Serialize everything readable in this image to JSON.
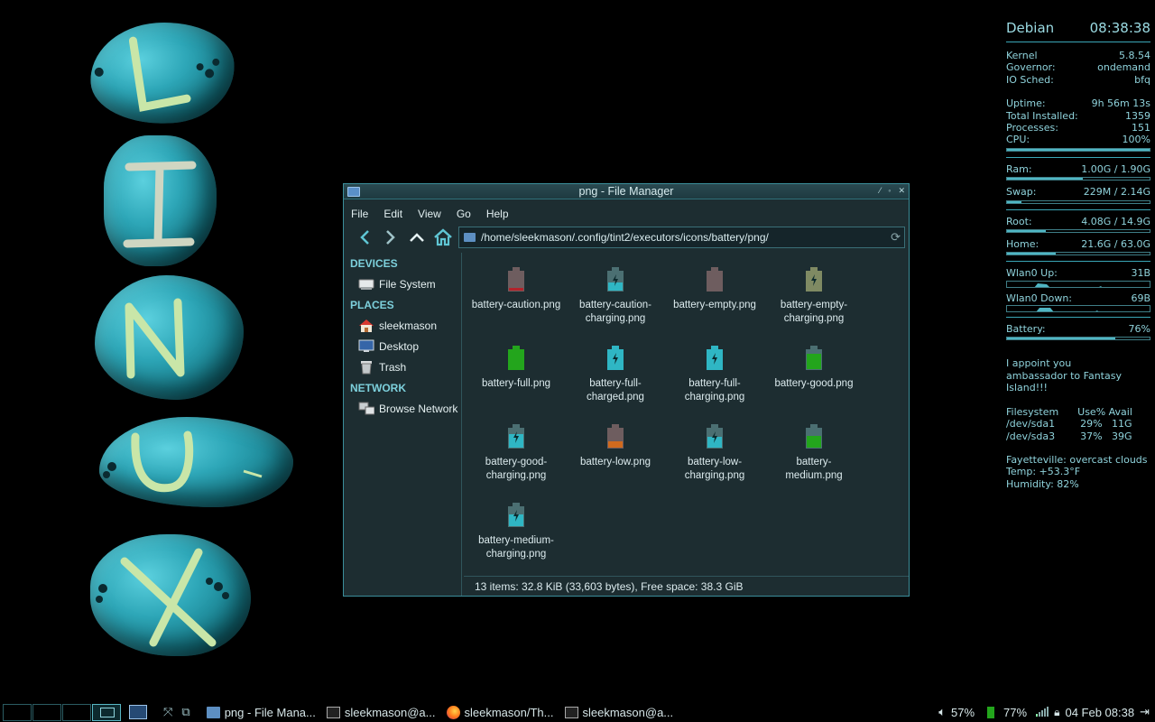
{
  "wallpaper": {
    "letters": [
      "L",
      "I",
      "N",
      "U",
      "X"
    ]
  },
  "conky": {
    "distro": "Debian",
    "time": "08:38:38",
    "rows1": [
      {
        "k": "Kernel",
        "v": "5.8.54"
      },
      {
        "k": "Governor:",
        "v": "ondemand"
      },
      {
        "k": "IO Sched:",
        "v": "bfq"
      }
    ],
    "rows2": [
      {
        "k": "Uptime:",
        "v": "9h 56m 13s"
      },
      {
        "k": "Total Installed:",
        "v": "1359"
      },
      {
        "k": "Processes:",
        "v": "151"
      },
      {
        "k": "CPU:",
        "v": "100%"
      }
    ],
    "cpu_fraction": 1.0,
    "ram": {
      "k": "Ram:",
      "v": "1.00G  / 1.90G",
      "fraction": 0.53
    },
    "swap": {
      "k": "Swap:",
      "v": "229M  / 2.14G",
      "fraction": 0.1
    },
    "root": {
      "k": "Root:",
      "v": "4.08G / 14.9G",
      "fraction": 0.27
    },
    "home": {
      "k": "Home:",
      "v": "21.6G / 63.0G",
      "fraction": 0.34
    },
    "wlan_up": {
      "k": "Wlan0 Up:",
      "v": "31B"
    },
    "wlan_down": {
      "k": "Wlan0 Down:",
      "v": "69B"
    },
    "battery": {
      "k": "Battery:",
      "v": "76%",
      "fraction": 0.76
    },
    "fortune": "I appoint you\nambassador to Fantasy\nIsland!!!",
    "fs_header": "Filesystem      Use% Avail",
    "fs_rows": [
      "/dev/sda1        29%   11G",
      "/dev/sda3        37%   39G"
    ],
    "weather": [
      "Fayetteville: overcast clouds",
      "Temp: +53.3°F",
      "Humidity: 82%"
    ]
  },
  "window": {
    "title": "png - File Manager",
    "menu": [
      "File",
      "Edit",
      "View",
      "Go",
      "Help"
    ],
    "path": "/home/sleekmason/.config/tint2/executors/icons/battery/png/",
    "sidebar": {
      "devices_label": "DEVICES",
      "devices": [
        "File System"
      ],
      "places_label": "PLACES",
      "places": [
        "sleekmason",
        "Desktop",
        "Trash"
      ],
      "network_label": "NETWORK",
      "network": [
        "Browse Network"
      ]
    },
    "files": [
      {
        "name": "battery-caution.png",
        "fill": 0.15,
        "fill_color": "#b3232b",
        "body": "#6e5d5f",
        "charging": false
      },
      {
        "name": "battery-caution-\ncharging.png",
        "fill": 0.45,
        "fill_color": "#2fb6c4",
        "body": "#4b6f72",
        "charging": true
      },
      {
        "name": "battery-empty.png",
        "fill": 0.0,
        "fill_color": "#6e5d5f",
        "body": "#6e5d5f",
        "charging": false
      },
      {
        "name": "battery-empty-\ncharging.png",
        "fill": 0.0,
        "fill_color": "#7f8a63",
        "body": "#7f8a63",
        "charging": true
      },
      {
        "name": "battery-full.png",
        "fill": 1.0,
        "fill_color": "#23a51c",
        "body": "#23a51c",
        "charging": false
      },
      {
        "name": "battery-full-\ncharged.png",
        "fill": 1.0,
        "fill_color": "#2fb6c4",
        "body": "#2fb6c4",
        "charging": true
      },
      {
        "name": "battery-full-\ncharging.png",
        "fill": 1.0,
        "fill_color": "#2fb6c4",
        "body": "#2fb6c4",
        "charging": true
      },
      {
        "name": "battery-good.png",
        "fill": 0.8,
        "fill_color": "#23a51c",
        "body": "#4b6f72",
        "charging": false
      },
      {
        "name": "battery-good-\ncharging.png",
        "fill": 0.7,
        "fill_color": "#2fb6c4",
        "body": "#4b6f72",
        "charging": true
      },
      {
        "name": "battery-low.png",
        "fill": 0.35,
        "fill_color": "#d06a1e",
        "body": "#6e5d5f",
        "charging": false
      },
      {
        "name": "battery-low-\ncharging.png",
        "fill": 0.55,
        "fill_color": "#2fb6c4",
        "body": "#4b6f72",
        "charging": true
      },
      {
        "name": "battery-\nmedium.png",
        "fill": 0.6,
        "fill_color": "#23a51c",
        "body": "#4b6f72",
        "charging": false
      },
      {
        "name": "battery-medium-\ncharging.png",
        "fill": 0.6,
        "fill_color": "#2fb6c4",
        "body": "#4b6f72",
        "charging": true
      }
    ],
    "status": "13 items: 32.8 KiB (33,603 bytes), Free space: 38.3 GiB"
  },
  "taskbar": {
    "tasks": [
      {
        "label": "png - File Mana...",
        "icon": "folder-icon"
      },
      {
        "label": "sleekmason@a...",
        "icon": "terminal-icon"
      },
      {
        "label": "sleekmason/Th...",
        "icon": "firefox-icon"
      },
      {
        "label": "sleekmason@a...",
        "icon": "terminal-icon"
      }
    ],
    "volume": "57%",
    "battery": "77%",
    "clock": "04 Feb 08:38"
  },
  "colors": {
    "accent": "#3aa6b6",
    "window_bg": "#1d2d31",
    "text": "#dcebee"
  }
}
